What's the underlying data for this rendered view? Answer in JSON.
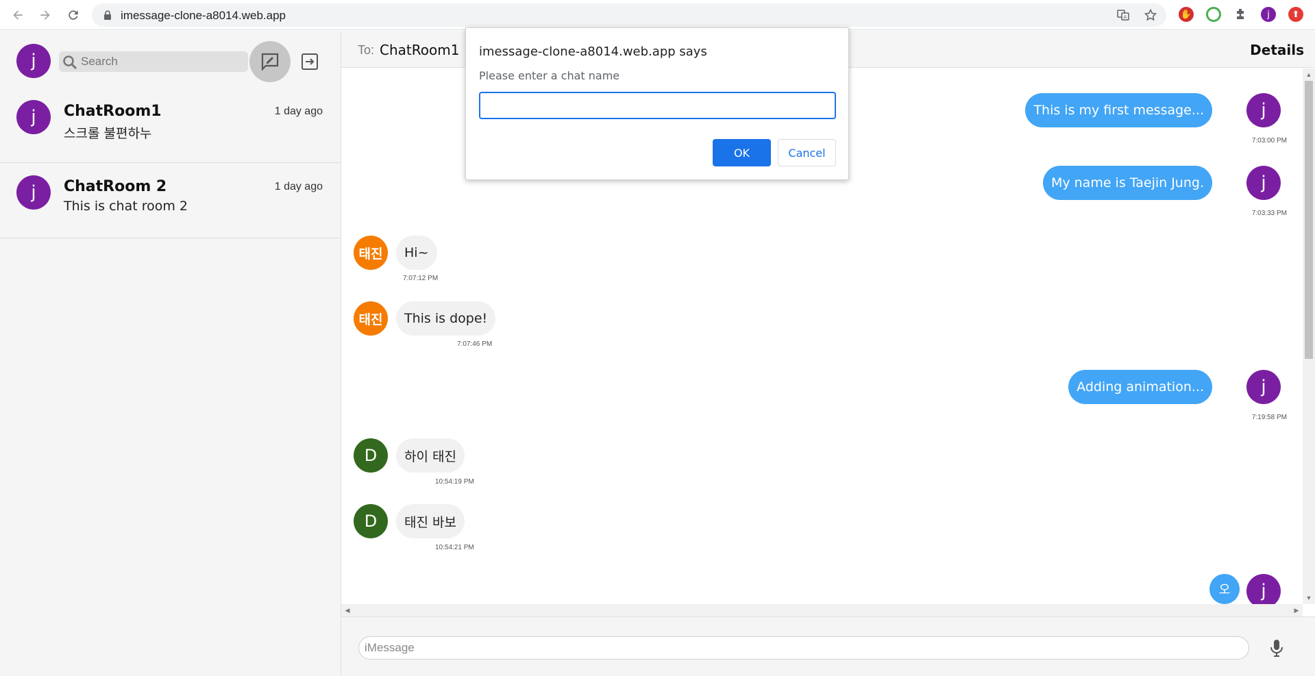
{
  "browser": {
    "url": "imessage-clone-a8014.web.app",
    "profile_initial": "j",
    "icons": [
      "back-icon",
      "forward-icon",
      "reload-icon",
      "lock-icon",
      "translate-icon",
      "star-icon",
      "puzzle-icon"
    ]
  },
  "sidebar": {
    "user_initial": "j",
    "search_placeholder": "Search",
    "chats": [
      {
        "initial": "j",
        "name": "ChatRoom1",
        "time": "1 day ago",
        "preview": "스크롤 불편하누"
      },
      {
        "initial": "j",
        "name": "ChatRoom 2",
        "time": "1 day ago",
        "preview": "This is chat room 2"
      }
    ]
  },
  "chat": {
    "to_label": "To:",
    "to_name": "ChatRoom1",
    "details_label": "Details",
    "messages": [
      {
        "dir": "out",
        "initial": "j",
        "text": "This is my first message...",
        "time": "7:03:00 PM"
      },
      {
        "dir": "out",
        "initial": "j",
        "text": "My name is Taejin Jung.",
        "time": "7:03:33 PM"
      },
      {
        "dir": "in",
        "initial": "태진",
        "text": "Hi~",
        "time": "7:07:12 PM"
      },
      {
        "dir": "in",
        "initial": "태진",
        "text": "This is dope!",
        "time": "7:07:46 PM"
      },
      {
        "dir": "out",
        "initial": "j",
        "text": "Adding animation...",
        "time": "7:19:58 PM"
      },
      {
        "dir": "in",
        "initial": "D",
        "text": "하이 태진",
        "time": "10:54:19 PM"
      },
      {
        "dir": "in",
        "initial": "D",
        "text": "태진 바보",
        "time": "10:54:21 PM"
      },
      {
        "dir": "out",
        "initial": "j",
        "text": "오",
        "time": ""
      }
    ],
    "input_placeholder": "iMessage"
  },
  "dialog": {
    "title": "imessage-clone-a8014.web.app says",
    "message": "Please enter a chat name",
    "input_value": "",
    "ok_label": "OK",
    "cancel_label": "Cancel"
  },
  "colors": {
    "accent_blue": "#42a5f5",
    "user_purple": "#7b1fa2",
    "taejin_orange": "#f57c00",
    "d_green": "#33691e",
    "dialog_blue": "#1a73e8"
  }
}
